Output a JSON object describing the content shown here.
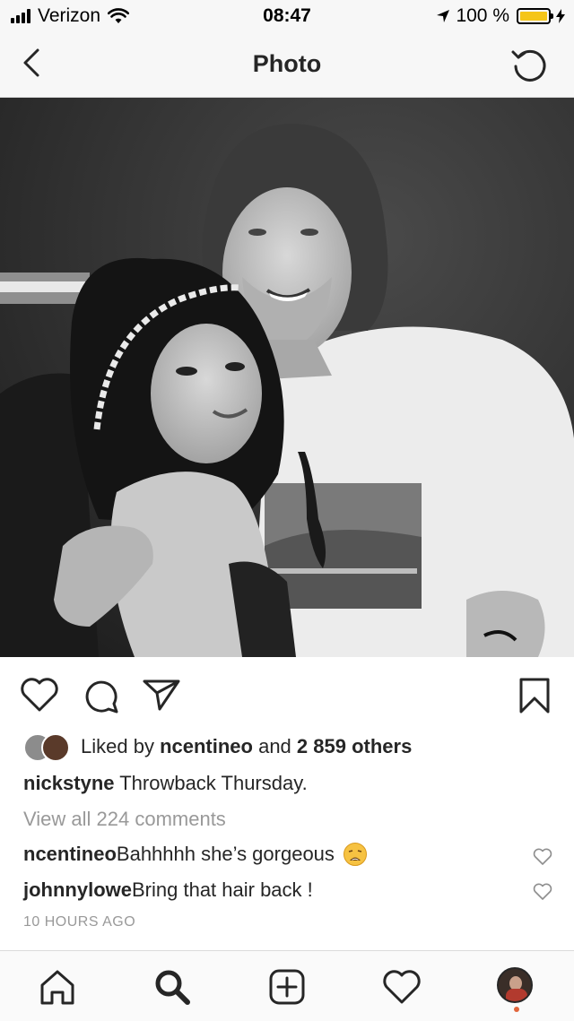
{
  "status_bar": {
    "carrier": "Verizon",
    "time": "08:47",
    "battery_percent": "100 %",
    "battery_level": 1.0,
    "battery_color": "#f5c518"
  },
  "nav": {
    "title": "Photo",
    "back_icon": "chevron-left-icon",
    "refresh_icon": "refresh-icon"
  },
  "post": {
    "photo_description_icon": "photo",
    "likes": {
      "prefix": "Liked by ",
      "user": "ncentineo",
      "middle": " and ",
      "count": "2 859 others"
    },
    "caption": {
      "username": "nickstyne",
      "text": " Throwback Thursday."
    },
    "view_comments": "View all 224 comments",
    "comments": [
      {
        "username": "ncentineo",
        "text": " Bahhhhh she’s gorgeous",
        "emoji": "weary-face-emoji"
      },
      {
        "username": "johnnylowe",
        "text": " Bring that hair back !"
      }
    ],
    "timestamp": "10 HOURS AGO"
  },
  "tab_bar": {
    "items": [
      "home-icon",
      "search-icon",
      "add-post-icon",
      "activity-heart-icon",
      "profile-avatar"
    ],
    "notification_dot_color": "#e1653b"
  }
}
